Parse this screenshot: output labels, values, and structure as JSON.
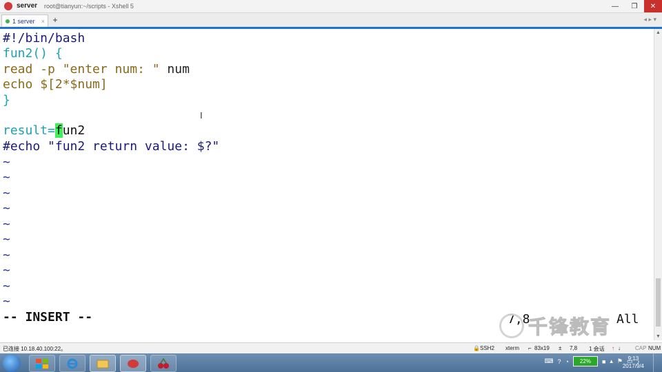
{
  "titlebar": {
    "app": "server",
    "full_title": "root@tianyun:~/scripts - Xshell 5",
    "buttons": {
      "minimize": "—",
      "maximize": "❐",
      "close": "✕"
    }
  },
  "tabs": {
    "items": [
      {
        "label": "1 server",
        "close": "×"
      }
    ],
    "add_label": "+",
    "nav_label": "◂ ▸ ▾"
  },
  "editor": {
    "lines": [
      "#!/bin/bash",
      "fun2() {",
      "read -p \"enter num: \" num",
      "echo $[2*$num]",
      "}",
      "",
      "result=fun2",
      "#echo \"fun2 return value: $?\""
    ],
    "line3_cmd": "read -p",
    "line3_str": "\"enter num: \"",
    "line3_var": " num",
    "line4_cmd": "echo",
    "line4_expr": " $[2*$num]",
    "line7_pre": "result=",
    "line7_cursor_char": "f",
    "line7_post": "un2",
    "tilde": "~",
    "mode": "-- INSERT --",
    "position": "7,8",
    "scope": "All"
  },
  "watermark": {
    "text": "千锋教育"
  },
  "statusbar": {
    "connection": "已连接 10.18.40.100:22。",
    "protocol": "SSH2",
    "terminal": "xterm",
    "size": "83x19",
    "cursor_pos": "7,8",
    "sessions": "1 会话",
    "caps": "CAP",
    "num": "NUM"
  },
  "taskbar": {
    "battery": "22%",
    "time": "9:13",
    "date": "2017/9/4"
  },
  "colors": {
    "accent": "#1e6fd8",
    "cursor": "#3ef05a",
    "close_button": "#c9302c"
  }
}
